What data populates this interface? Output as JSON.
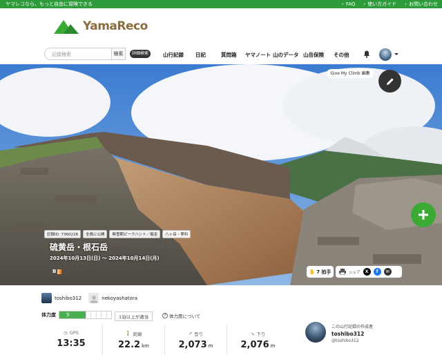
{
  "topbar": {
    "tagline": "ヤマレコなら、もっと自由に冒険できる",
    "links": [
      {
        "label": "FAQ"
      },
      {
        "label": "使い方ガイド"
      },
      {
        "label": "お問い合わせ"
      }
    ]
  },
  "header": {
    "logo": "YamaReco"
  },
  "nav": {
    "search_placeholder": "記録検索",
    "search_button": "検索",
    "detail_button": "詳細検索",
    "items": [
      "山行記録",
      "日記",
      "質問箱",
      "ヤマノート",
      "山のデータ",
      "山岳保険",
      "その他"
    ]
  },
  "hero": {
    "climb_button": "Give My Climb 編集",
    "tags": [
      "記録ID: 7360228",
      "全員に公開",
      "無雪期ピークハント／縦走",
      "八ヶ岳・蓼科"
    ],
    "title": "硫黄岳・根石岳",
    "date_range": "2024年10月13日(日) 〜 2024年10月14日(月)",
    "badge": "B",
    "claps": "7 拍手",
    "share_label": "シェア"
  },
  "members": {
    "user1": "toshibo312",
    "user2": "nekoyashatora"
  },
  "fitness": {
    "label": "体力度",
    "value": "5",
    "pace": "1泊以上が適当",
    "link": "体力度について"
  },
  "stats": [
    {
      "label": "GPS",
      "value": "13:35",
      "unit": ""
    },
    {
      "label": "距離",
      "value": "22.2",
      "unit": "km"
    },
    {
      "label": "登り",
      "value": "2,073",
      "unit": "m"
    },
    {
      "label": "下り",
      "value": "2,076",
      "unit": "m"
    }
  ],
  "author": {
    "caption": "この山行記録の作成者",
    "name": "toshibo312",
    "handle": "@toshibo312"
  },
  "colors": {
    "brand_green": "#2e9b3a",
    "action_green": "#3aaa35"
  }
}
